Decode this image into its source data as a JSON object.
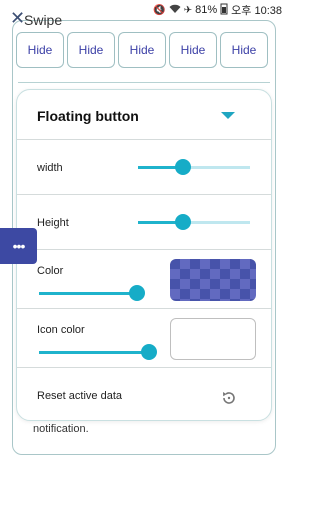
{
  "status_bar": {
    "battery": "81%",
    "time": "오후 10:38",
    "icons": [
      "mute-icon",
      "wifi-icon",
      "airplane-icon",
      "battery-icon"
    ]
  },
  "background": {
    "swipe_label": "Swipe",
    "hide_buttons": [
      "Hide",
      "Hide",
      "Hide",
      "Hide",
      "Hide"
    ],
    "notification_text": "notification."
  },
  "dialog": {
    "title": "Floating button",
    "rows": {
      "width": {
        "label": "width",
        "value_fraction": 0.4
      },
      "height": {
        "label": "Height",
        "value_fraction": 0.4
      },
      "color": {
        "label": "Color",
        "value_fraction": 1.0,
        "swatch_color": "#3e4aa6"
      },
      "icon_color": {
        "label": "Icon color",
        "value_fraction": 1.0,
        "swatch_color": "#ffffff"
      },
      "reset": {
        "label": "Reset active data"
      }
    }
  },
  "colors": {
    "accent": "#1fb3cc",
    "handle": "#3d49a3",
    "hide_text": "#3b3fa6"
  }
}
